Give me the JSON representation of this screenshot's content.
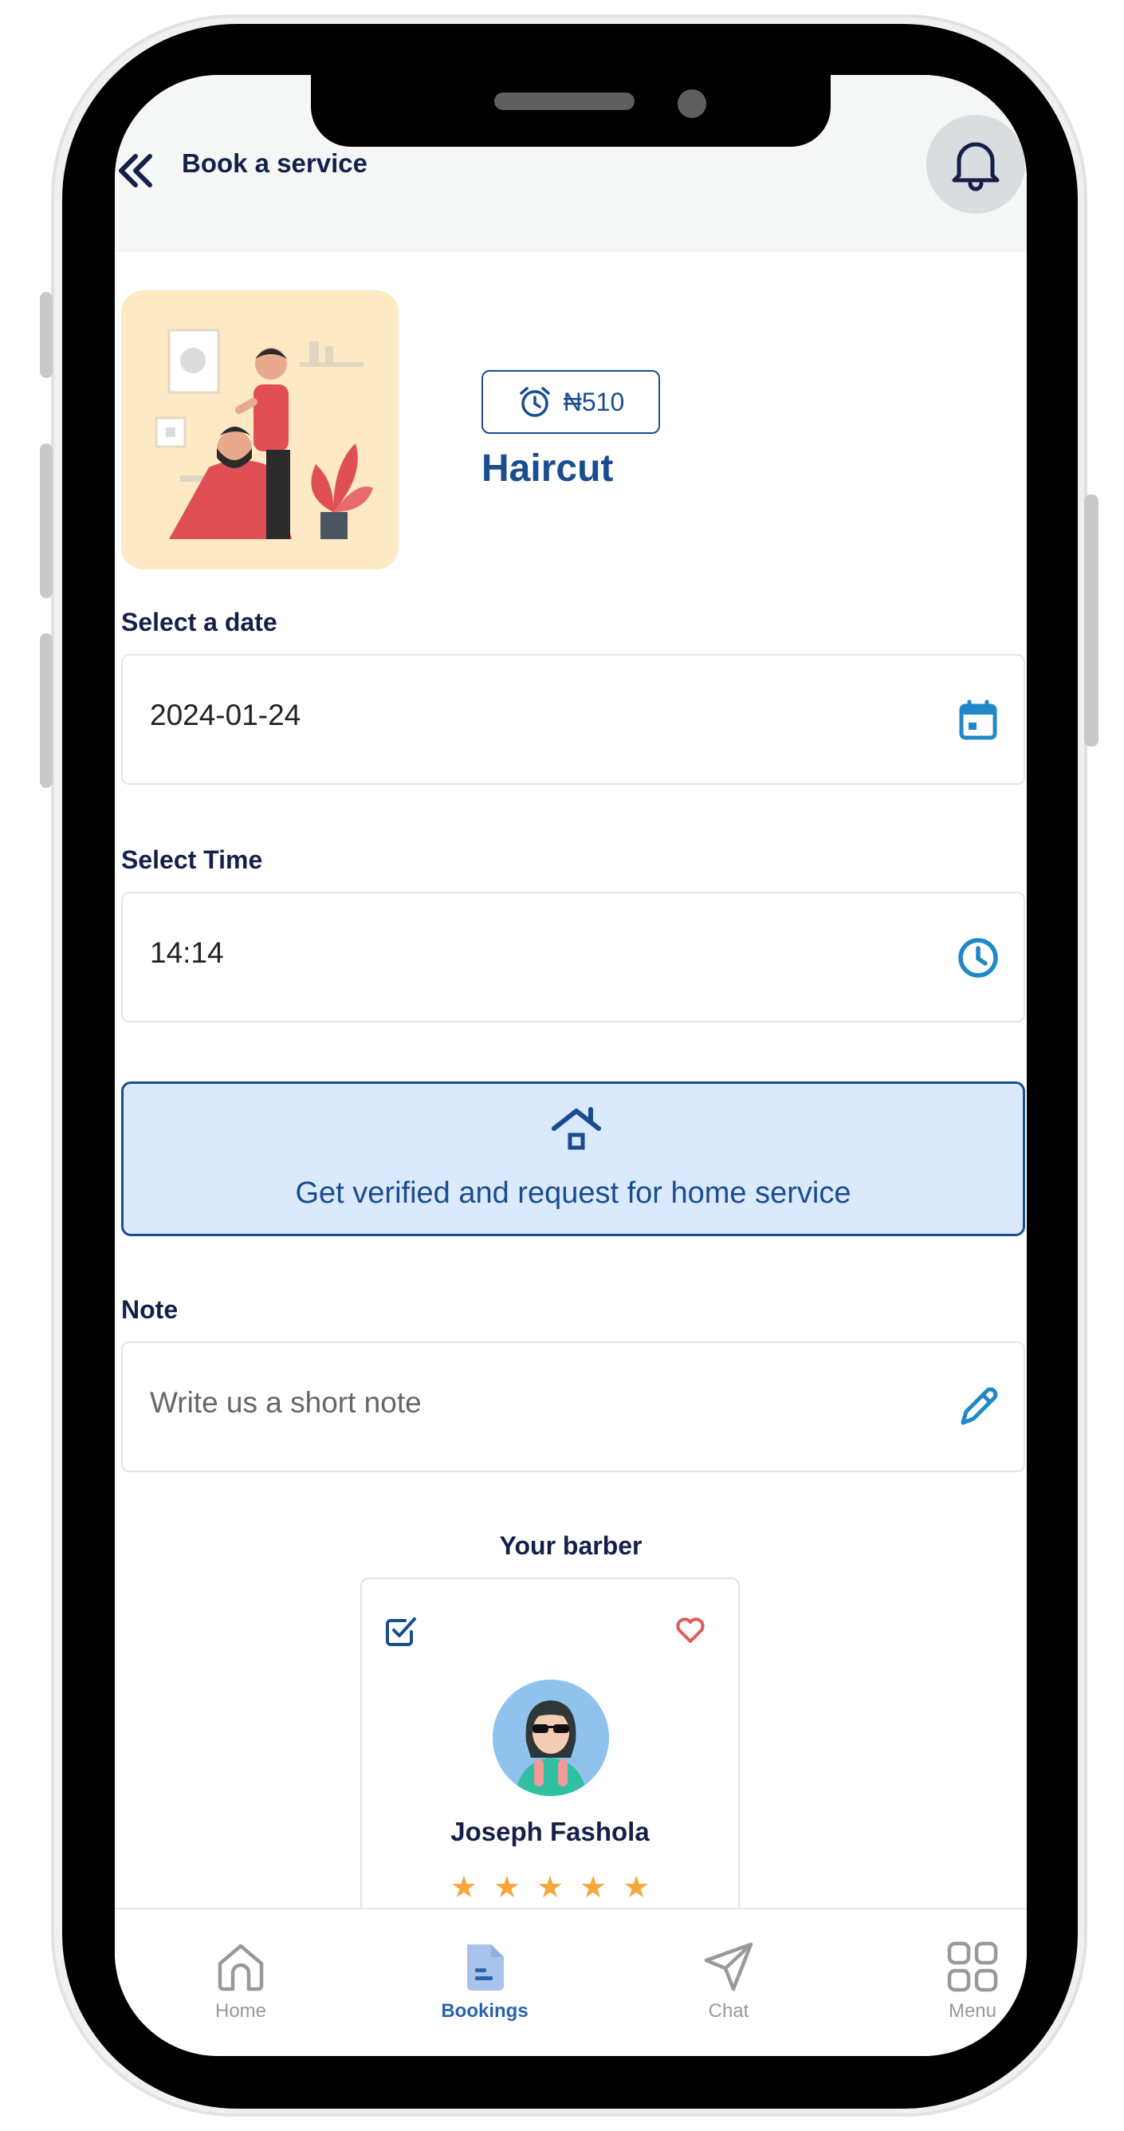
{
  "header": {
    "title": "Book a service"
  },
  "service": {
    "price": "₦510",
    "name": "Haircut"
  },
  "date": {
    "label": "Select a date",
    "value": "2024-01-24"
  },
  "time": {
    "label": "Select Time",
    "value": "14:14"
  },
  "home_service": {
    "text": "Get verified and request for home service"
  },
  "note": {
    "label": "Note",
    "placeholder": "Write us a short note"
  },
  "barber": {
    "heading": "Your barber",
    "name": "Joseph Fashola",
    "rating": 5,
    "stars": "★★★★★"
  },
  "nav": {
    "home": "Home",
    "bookings": "Bookings",
    "chat": "Chat",
    "menu": "Menu",
    "active": "Bookings"
  },
  "colors": {
    "brand": "#1a4d8f",
    "heading": "#14204a",
    "accent": "#1e88c8",
    "banner_bg": "#dbe9fc",
    "star": "#f4a83a",
    "heart": "#e05a5a"
  }
}
